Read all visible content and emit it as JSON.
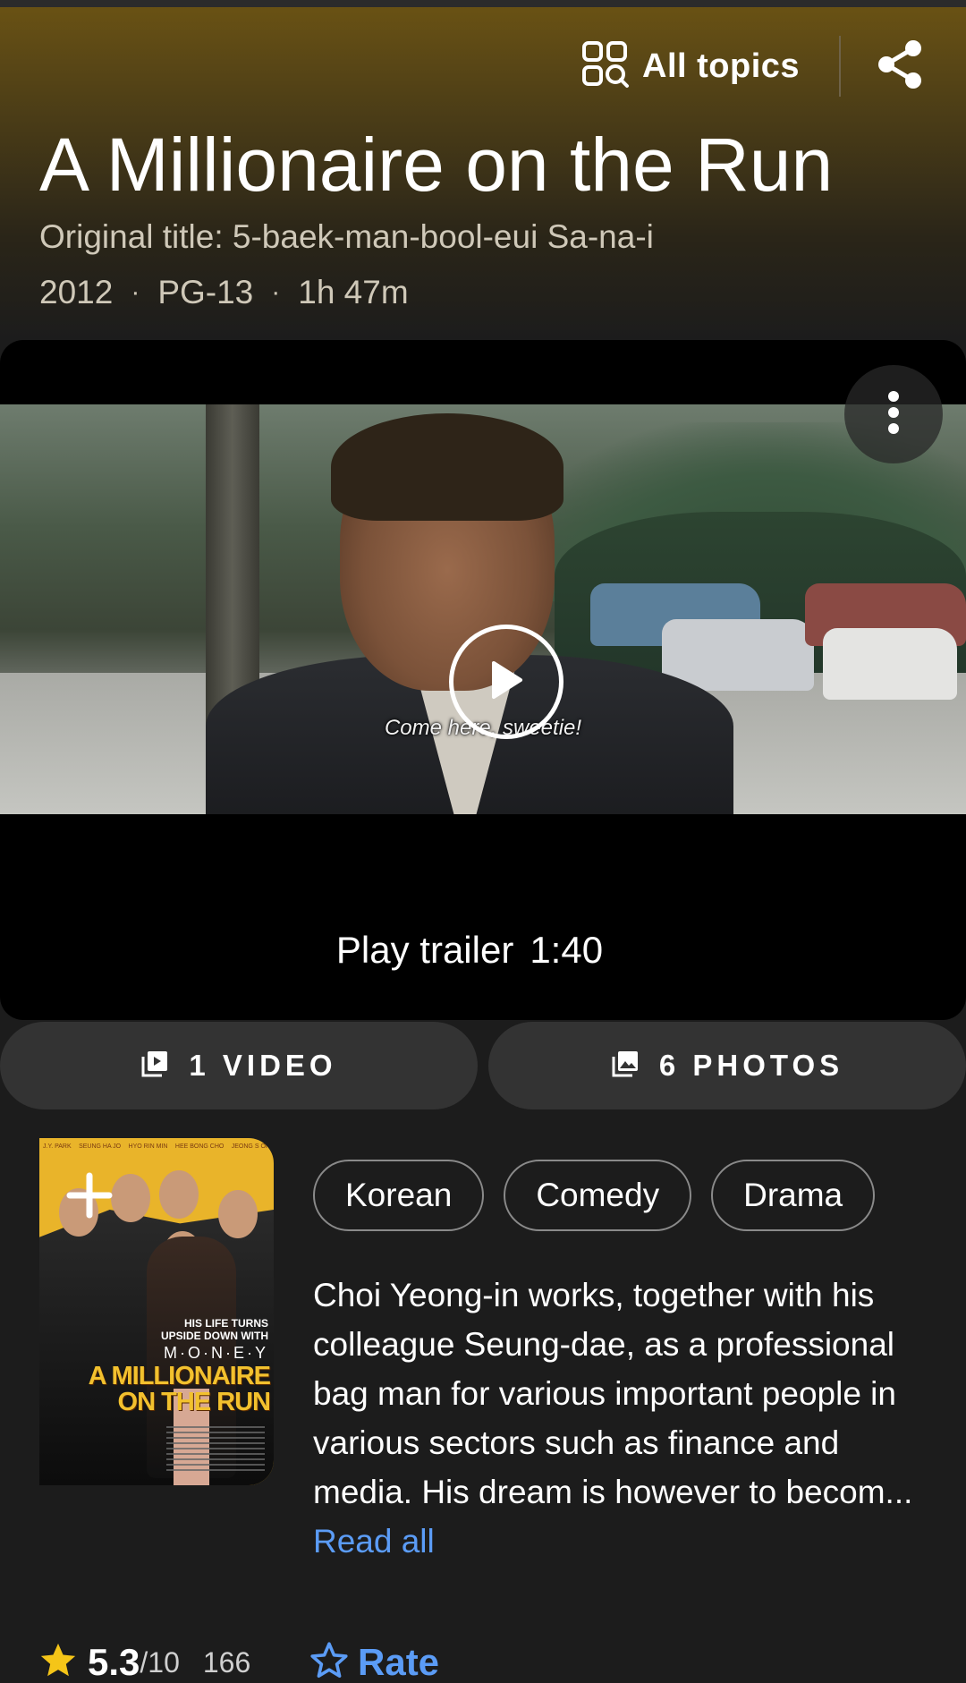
{
  "header": {
    "all_topics_label": "All topics",
    "title": "A Millionaire on the Run",
    "original_title": "Original title: 5-baek-man-bool-eui Sa-na-i",
    "year": "2012",
    "rating": "PG-13",
    "runtime": "1h 47m"
  },
  "player": {
    "subtitle": "Come here, sweetie!",
    "trailer_label": "Play trailer",
    "trailer_duration": "1:40"
  },
  "media": {
    "videos_label": "1 VIDEO",
    "photos_label": "6 PHOTOS"
  },
  "poster": {
    "cast": [
      "J.Y. PARK",
      "SEUNG HA JO",
      "HYO RIN MIN",
      "HEE BONG CHO",
      "JEONG S OH"
    ],
    "tagline_1": "HIS LIFE TURNS",
    "tagline_2": "UPSIDE DOWN WITH",
    "money": "M·O·N·E·Y",
    "title_1": "A MILLIONAIRE",
    "title_2": "ON THE RUN"
  },
  "genres": [
    "Korean",
    "Comedy",
    "Drama"
  ],
  "plot": {
    "text": "Choi Yeong-in works, together with his colleague Seung-dae, as a professional bag man for various important people in various sectors such as finance and media. His dream is however to becom...",
    "read_all": "Read all"
  },
  "rating": {
    "value": "5.3",
    "max": "/10",
    "count": "166",
    "rate_label": "Rate"
  },
  "colors": {
    "accent_link": "#5b9cf6",
    "star": "#f5c518",
    "header_gold": "#6b5314"
  },
  "icons": {
    "all_topics": "grid-search-icon",
    "share": "share-icon",
    "more": "more-vertical-icon",
    "play": "play-circle-icon",
    "video": "video-library-icon",
    "photos": "photo-library-icon",
    "add": "plus-icon",
    "star": "star-filled-icon",
    "rate": "star-outline-icon"
  }
}
